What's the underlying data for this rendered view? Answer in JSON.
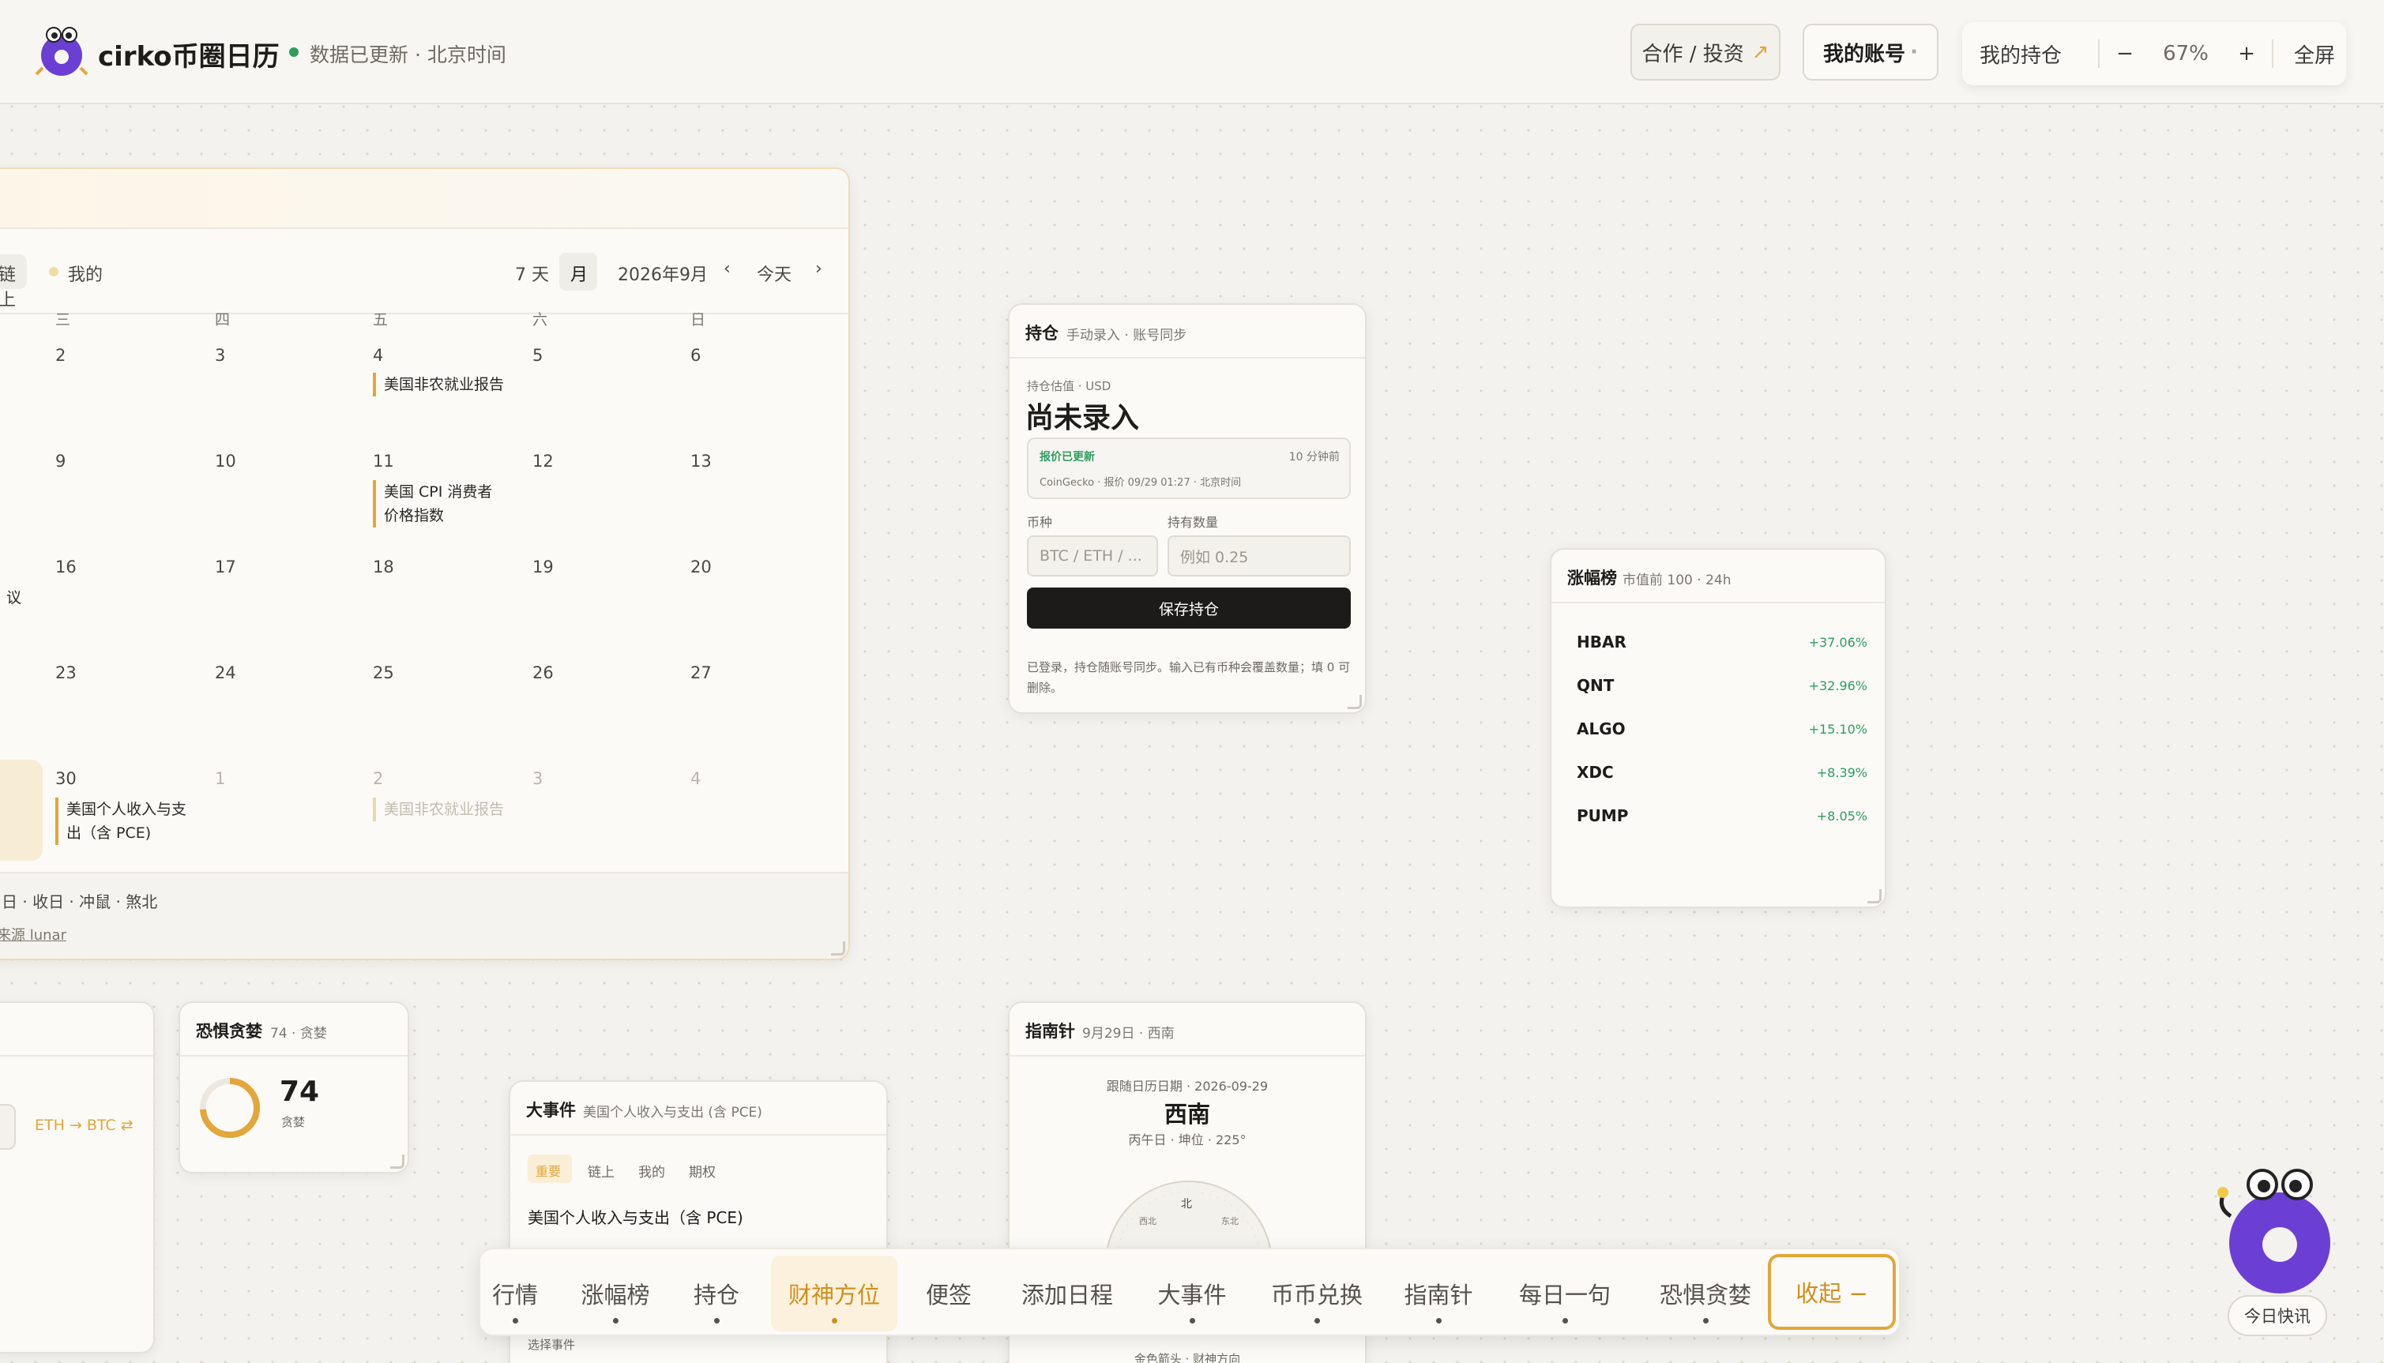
{
  "header": {
    "app_title": "cirko币圈日历",
    "status": "数据已更新 · 北京时间",
    "partner_btn": "合作 / 投资",
    "partner_arrow": "↗",
    "account_btn": "我的账号",
    "account_dot": "·",
    "holdings_btn": "我的持仓",
    "zoom_minus": "−",
    "zoom_level": "67%",
    "zoom_plus": "+",
    "fullscreen": "全屏"
  },
  "calendar": {
    "filter_onchain": "链上",
    "filter_mine": "我的",
    "view_7d": "7 天",
    "view_month": "月",
    "month_label": "2026年9月",
    "prev": "‹",
    "today": "今天",
    "next": "›",
    "weekdays": [
      "三",
      "四",
      "五",
      "六",
      "日"
    ],
    "weeks": [
      [
        "2",
        "3",
        "4",
        "5",
        "6"
      ],
      [
        "9",
        "10",
        "11",
        "12",
        "13"
      ],
      [
        "16",
        "17",
        "18",
        "19",
        "20"
      ],
      [
        "23",
        "24",
        "25",
        "26",
        "27"
      ],
      [
        "30",
        "1",
        "2",
        "3",
        "4"
      ]
    ],
    "events": {
      "nfp": "美国非农就业报告",
      "cpi_line1": "美国 CPI 消费者",
      "cpi_line2": "价格指数",
      "left_fragment": "议",
      "pce_line1": "美国个人收入与支",
      "pce_line2": "出（含 PCE)",
      "nfp_next": "美国非农就业报告"
    },
    "footer_line": "日 · 收日 · 冲鼠 · 煞北",
    "footer_source": "来源 lunar"
  },
  "holdings": {
    "title": "持仓",
    "subtitle": "手动录入 · 账号同步",
    "value_label": "持仓估值 · USD",
    "value": "尚未录入",
    "price_status": "报价已更新",
    "price_ago": "10 分钟前",
    "price_source": "CoinGecko · 报价 09/29 01:27 · 北京时间",
    "coin_label": "币种",
    "coin_placeholder": "BTC / ETH / ...",
    "qty_label": "持有数量",
    "qty_placeholder": "例如 0.25",
    "save_btn": "保存持仓",
    "note": "已登录，持仓随账号同步。输入已有币种会覆盖数量；填 0 可删除。"
  },
  "gainers": {
    "title": "涨幅榜",
    "subtitle": "市值前 100 · 24h",
    "rows": [
      {
        "symbol": "HBAR",
        "change": "+37.06%"
      },
      {
        "symbol": "QNT",
        "change": "+32.96%"
      },
      {
        "symbol": "ALGO",
        "change": "+15.10%"
      },
      {
        "symbol": "XDC",
        "change": "+8.39%"
      },
      {
        "symbol": "PUMP",
        "change": "+8.05%"
      }
    ]
  },
  "fear_greed": {
    "title": "恐惧贪婪",
    "subtitle": "74 · 贪婪",
    "value": "74",
    "label": "贪婪",
    "level": 0.74
  },
  "swap": {
    "pair": "ETH → BTC ⇄"
  },
  "events_card": {
    "title": "大事件",
    "subtitle": "美国个人收入与支出 (含 PCE)",
    "tabs": [
      "重要",
      "链上",
      "我的",
      "期权"
    ],
    "headline": "美国个人收入与支出（含 PCE)",
    "select_label": "选择事件"
  },
  "compass": {
    "title": "指南针",
    "subtitle": "9月29日 · 西南",
    "date_line": "跟随日历日期 · 2026-09-29",
    "direction": "西南",
    "detail": "丙午日 · 坤位 · 225°",
    "dial_north": "北",
    "dial_nw": "西北",
    "dial_ne": "东北",
    "bottom_note": "金色箭头 · 财神方向"
  },
  "dock": {
    "items": [
      "行情",
      "涨幅榜",
      "持仓",
      "财神方位",
      "便签",
      "添加日程",
      "大事件",
      "币币兑换",
      "指南针",
      "每日一句",
      "恐惧贪婪"
    ],
    "collapse": "收起 −"
  },
  "mascot": {
    "news_btn": "今日快讯"
  },
  "colors": {
    "accent": "#e3a63a",
    "positive": "#2e9e5e",
    "dark_button": "#1c1b19"
  }
}
